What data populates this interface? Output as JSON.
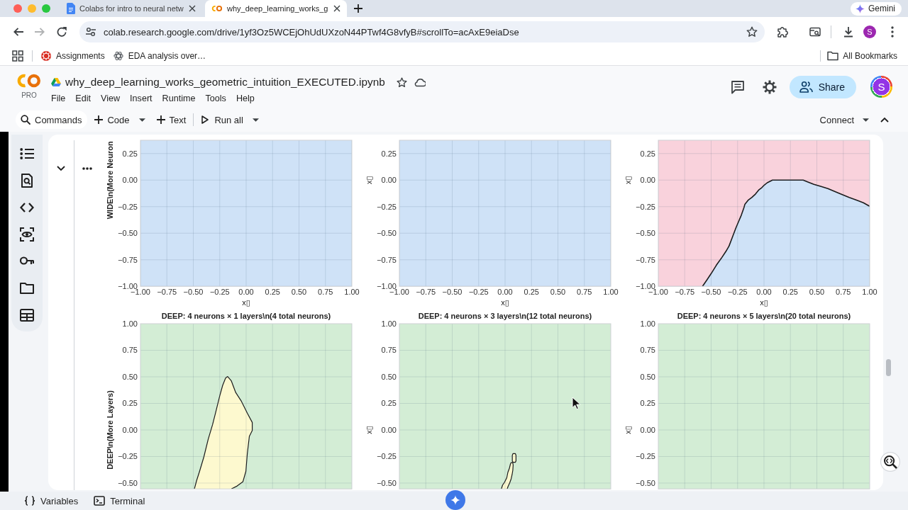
{
  "browser": {
    "tabs": [
      {
        "kind": "document",
        "title": "Colabs for intro to neural netw",
        "selected": false
      },
      {
        "kind": "notebook",
        "title": "why_deep_learning_works_g",
        "selected": true
      }
    ],
    "assistant_label": "Gemini",
    "forward_disabled": true,
    "url": "colab.research.google.com/drive/1yf3Oz5WCEjOhUdUXzoN44PTwf4G8vfyB#scrollTo=acAxE9eiaDse",
    "profile_initial": "S",
    "bookmarks": [
      {
        "kind": "badge",
        "label": "Assignments"
      },
      {
        "kind": "atom",
        "label": "EDA analysis over…"
      }
    ],
    "all_bookmarks": "All Bookmarks"
  },
  "notebook": {
    "title": "why_deep_learning_works_geometric_intuition_EXECUTED.ipynb",
    "plan": "PRO",
    "menu": [
      "File",
      "Edit",
      "View",
      "Insert",
      "Runtime",
      "Tools",
      "Help"
    ],
    "share": "Share",
    "account_initial": "S"
  },
  "toolbar": {
    "commands": "Commands",
    "add_code": "Code",
    "add_text": "Text",
    "run_all": "Run all",
    "connect": "Connect"
  },
  "output": {
    "charts": [
      {
        "regions": [
          {
            "kind": "background",
            "color": "#cfe2f7"
          }
        ],
        "chart_data": {
          "type": "line",
          "ylabel": "WIDE\\n(More Neuron",
          "xlabel": "x▯",
          "xlim": [
            -1,
            1
          ],
          "ylim": [
            -1,
            0.375
          ],
          "grid": true,
          "xticks": [
            {
              "value": -1,
              "label": "−1.00"
            },
            {
              "value": -0.75,
              "label": "−0.75"
            },
            {
              "value": -0.5,
              "label": "−0.50"
            },
            {
              "value": -0.25,
              "label": "−0.25"
            },
            {
              "value": 0,
              "label": "0.00"
            },
            {
              "value": 0.25,
              "label": "0.25"
            },
            {
              "value": 0.5,
              "label": "0.50"
            },
            {
              "value": 0.75,
              "label": "0.75"
            },
            {
              "value": 1,
              "label": "1.00"
            }
          ],
          "yticks": [
            {
              "value": -1,
              "label": "−1.00"
            },
            {
              "value": -0.75,
              "label": "−0.75"
            },
            {
              "value": -0.5,
              "label": "−0.50"
            },
            {
              "value": -0.25,
              "label": "−0.25"
            },
            {
              "value": 0,
              "label": "0.00"
            },
            {
              "value": 0.25,
              "label": "0.25"
            }
          ]
        }
      },
      {
        "regions": [
          {
            "kind": "background",
            "color": "#cfe2f7"
          }
        ],
        "chart_data": {
          "type": "line",
          "ylabel": "x▯",
          "xlabel": "x▯",
          "xlim": [
            -1,
            1
          ],
          "ylim": [
            -1,
            0.375
          ],
          "grid": true,
          "xticks": [
            {
              "value": -1,
              "label": "−1.00"
            },
            {
              "value": -0.75,
              "label": "−0.75"
            },
            {
              "value": -0.5,
              "label": "−0.50"
            },
            {
              "value": -0.25,
              "label": "−0.25"
            },
            {
              "value": 0,
              "label": "0.00"
            },
            {
              "value": 0.25,
              "label": "0.25"
            },
            {
              "value": 0.5,
              "label": "0.50"
            },
            {
              "value": 0.75,
              "label": "0.75"
            },
            {
              "value": 1,
              "label": "1.00"
            }
          ],
          "yticks": [
            {
              "value": -1,
              "label": "−1.00"
            },
            {
              "value": -0.75,
              "label": "−0.75"
            },
            {
              "value": -0.5,
              "label": "−0.50"
            },
            {
              "value": -0.25,
              "label": "−0.25"
            },
            {
              "value": 0,
              "label": "0.00"
            },
            {
              "value": 0.25,
              "label": "0.25"
            }
          ]
        }
      },
      {
        "regions": [
          {
            "kind": "background",
            "color": "#f9d2dc"
          },
          {
            "kind": "enclosed",
            "color": "#cfe2f7"
          }
        ],
        "chart_data": {
          "type": "line",
          "ylabel": "x▯",
          "xlabel": "x▯",
          "xlim": [
            -1,
            1
          ],
          "ylim": [
            -1,
            0.375
          ],
          "grid": true,
          "xticks": [
            {
              "value": -1,
              "label": "−1.00"
            },
            {
              "value": -0.75,
              "label": "−0.75"
            },
            {
              "value": -0.5,
              "label": "−0.50"
            },
            {
              "value": -0.25,
              "label": "−0.25"
            },
            {
              "value": 0,
              "label": "0.00"
            },
            {
              "value": 0.25,
              "label": "0.25"
            },
            {
              "value": 0.5,
              "label": "0.50"
            },
            {
              "value": 0.75,
              "label": "0.75"
            },
            {
              "value": 1,
              "label": "1.00"
            }
          ],
          "yticks": [
            {
              "value": -1,
              "label": "−1.00"
            },
            {
              "value": -0.75,
              "label": "−0.75"
            },
            {
              "value": -0.5,
              "label": "−0.50"
            },
            {
              "value": -0.25,
              "label": "−0.25"
            },
            {
              "value": 0,
              "label": "0.00"
            },
            {
              "value": 0.25,
              "label": "0.25"
            }
          ],
          "x": [
            -0.582,
            -0.54,
            -0.498,
            -0.45,
            -0.398,
            -0.36,
            -0.331,
            -0.3,
            -0.264,
            -0.24,
            -0.214,
            -0.19,
            -0.181,
            -0.15,
            -0.114,
            -0.08,
            -0.047,
            -0.02,
            0.003,
            0.03,
            0.054,
            0.08,
            0.371,
            0.42,
            0.472,
            0.54,
            0.605,
            0.7,
            0.806,
            0.88,
            0.94,
            1
          ],
          "series": [
            {
              "color": "#1c1c1c",
              "values": [
                -1,
                -0.94,
                -0.877,
                -0.8,
                -0.728,
                -0.67,
                -0.621,
                -0.54,
                -0.445,
                -0.39,
                -0.329,
                -0.26,
                -0.229,
                -0.19,
                -0.163,
                -0.13,
                -0.09,
                -0.07,
                -0.047,
                -0.025,
                -0.013,
                0,
                0,
                -0.02,
                -0.04,
                -0.06,
                -0.08,
                -0.12,
                -0.163,
                -0.19,
                -0.213,
                -0.246
              ]
            }
          ]
        }
      },
      {
        "title": "DEEP: 4 neurons × 1 layers\\n(4 total neurons)",
        "ylabel": "DEEP\\n(More Layers)",
        "y_tick_labels": [
          "1.00",
          "0.75",
          "0.50",
          "0.25",
          "0.00",
          "−0.25",
          "−0.50"
        ],
        "regions": [
          {
            "kind": "background",
            "color": "#d3edd5"
          },
          {
            "kind": "tall-blob",
            "color": "#fdf9cf"
          }
        ]
      },
      {
        "title": "DEEP: 4 neurons × 3 layers\\n(12 total neurons)",
        "ylabel": "x▯",
        "y_tick_labels": [
          "1.00",
          "0.75",
          "0.50",
          "0.25",
          "0.00",
          "−0.25",
          "−0.50"
        ],
        "regions": [
          {
            "kind": "background",
            "color": "#d3edd5"
          },
          {
            "kind": "small-loop",
            "color": "#fdf9cf"
          },
          {
            "kind": "sliver",
            "color": "#fdf9cf"
          }
        ]
      },
      {
        "title": "DEEP: 4 neurons × 5 layers\\n(20 total neurons)",
        "ylabel": "x▯",
        "y_tick_labels": [
          "1.00",
          "0.75",
          "0.50",
          "0.25",
          "0.00",
          "−0.25",
          "−0.50"
        ],
        "regions": [
          {
            "kind": "background",
            "color": "#d3edd5"
          }
        ]
      }
    ]
  },
  "bottom_bar": {
    "variables": "Variables",
    "terminal": "Terminal"
  }
}
